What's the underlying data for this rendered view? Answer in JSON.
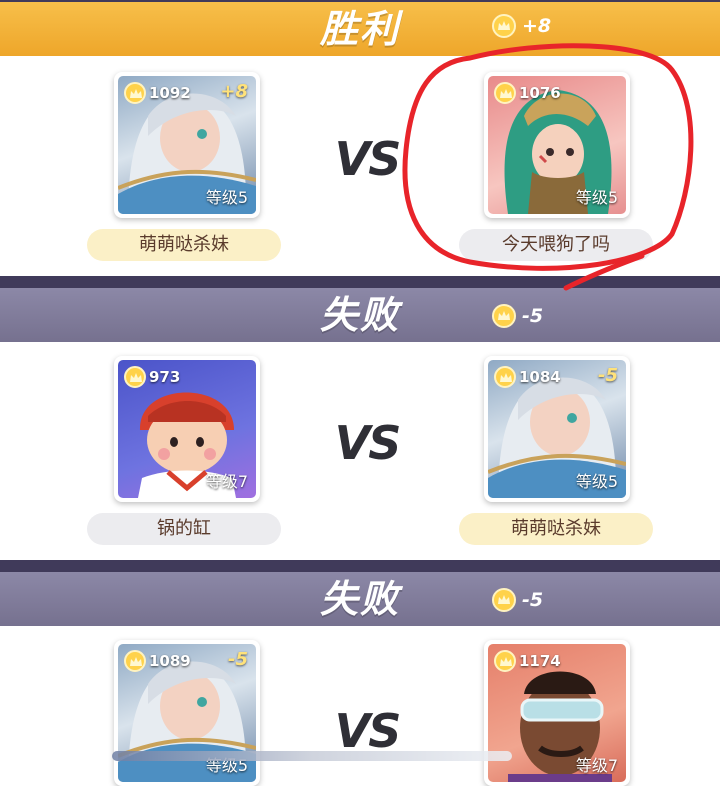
{
  "matches": [
    {
      "result": "胜利",
      "star_delta": "+8",
      "left": {
        "score": "1092",
        "delta": "+8",
        "level": "等级5",
        "name": "萌萌哒杀妹",
        "hero": "silver-hair-warrior"
      },
      "right": {
        "score": "1076",
        "delta": "",
        "level": "等级5",
        "name": "今天喂狗了吗",
        "hero": "green-hair-knight"
      },
      "vs": "VS"
    },
    {
      "result": "失败",
      "star_delta": "-5",
      "left": {
        "score": "973",
        "delta": "",
        "level": "等级7",
        "name": "锅的缸",
        "hero": "red-helmet-girl"
      },
      "right": {
        "score": "1084",
        "delta": "-5",
        "level": "等级5",
        "name": "萌萌哒杀妹",
        "hero": "silver-hair-warrior"
      },
      "vs": "VS"
    },
    {
      "result": "失败",
      "star_delta": "-5",
      "left": {
        "score": "1089",
        "delta": "-5",
        "level": "等级5",
        "name": "",
        "hero": "silver-hair-warrior"
      },
      "right": {
        "score": "1174",
        "delta": "",
        "level": "等级7",
        "name": "",
        "hero": "visor-man"
      },
      "vs": "VS"
    }
  ],
  "colors": {
    "win_banner": "#f3b43a",
    "lose_banner": "#807c9a",
    "annotation": "#e8242a",
    "name_pill_gold": "#fbf0c7",
    "name_pill_gray": "#ececef"
  },
  "icons": {
    "star": "crown-star-icon"
  }
}
